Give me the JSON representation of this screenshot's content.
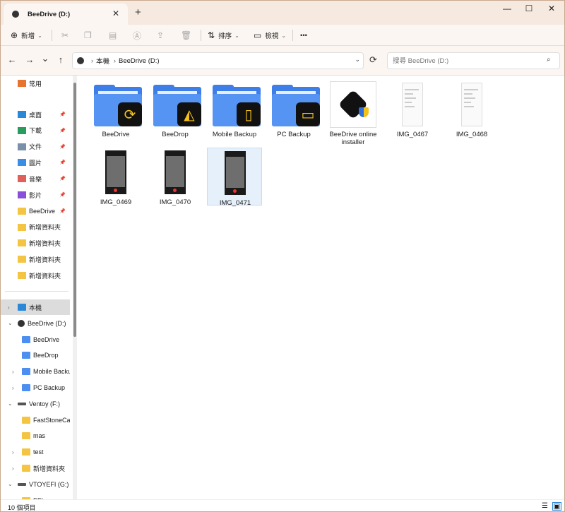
{
  "tab": {
    "title": "BeeDrive (D:)",
    "close": "✕",
    "new": "+"
  },
  "window": {
    "minimize": "—",
    "maximize": "☐",
    "close": "✕"
  },
  "toolbar": {
    "new_label": "新增",
    "sort_label": "排序",
    "view_label": "檢視",
    "more": "•••"
  },
  "nav": {
    "back": "←",
    "forward": "→",
    "recent": "⌄",
    "up": "↑",
    "refresh": "⟳",
    "breadcrumb": [
      "本機",
      "BeeDrive (D:)"
    ],
    "search_placeholder": "搜尋 BeeDrive (D:)"
  },
  "sidebar": {
    "home": "常用",
    "quick": [
      {
        "label": "桌面",
        "icon": "desktop-icon",
        "pinned": true
      },
      {
        "label": "下載",
        "icon": "download-icon",
        "pinned": true
      },
      {
        "label": "文件",
        "icon": "document-icon",
        "pinned": true
      },
      {
        "label": "圖片",
        "icon": "picture-icon",
        "pinned": true
      },
      {
        "label": "音樂",
        "icon": "music-icon",
        "pinned": true
      },
      {
        "label": "影片",
        "icon": "video-icon",
        "pinned": true
      },
      {
        "label": "BeeDrive",
        "icon": "folder-icon",
        "pinned": true
      },
      {
        "label": "新增資料夾",
        "icon": "folder-icon",
        "pinned": false
      },
      {
        "label": "新增資料夾",
        "icon": "folder-icon",
        "pinned": false
      },
      {
        "label": "新增資料夾",
        "icon": "folder-icon",
        "pinned": false
      },
      {
        "label": "新增資料夾",
        "icon": "folder-icon",
        "pinned": false
      }
    ],
    "tree": [
      {
        "label": "本機",
        "indent": 0,
        "exp": ">",
        "type": "pc"
      },
      {
        "label": "BeeDrive (D:)",
        "indent": 0,
        "exp": "v",
        "type": "drive"
      },
      {
        "label": "BeeDrive",
        "indent": 1,
        "exp": "",
        "type": "bd"
      },
      {
        "label": "BeeDrop",
        "indent": 1,
        "exp": "",
        "type": "bd"
      },
      {
        "label": "Mobile Backup",
        "indent": 1,
        "exp": ">",
        "type": "bd"
      },
      {
        "label": "PC Backup",
        "indent": 1,
        "exp": ">",
        "type": "bd"
      },
      {
        "label": "Ventoy (F:)",
        "indent": 0,
        "exp": "v",
        "type": "usb"
      },
      {
        "label": "FastStoneCapture",
        "indent": 1,
        "exp": "",
        "type": "folder"
      },
      {
        "label": "mas",
        "indent": 1,
        "exp": "",
        "type": "folder"
      },
      {
        "label": "test",
        "indent": 1,
        "exp": ">",
        "type": "folder"
      },
      {
        "label": "新增資料夾",
        "indent": 1,
        "exp": ">",
        "type": "folder"
      },
      {
        "label": "VTOYEFI (G:)",
        "indent": 0,
        "exp": "v",
        "type": "usb"
      },
      {
        "label": "EFI",
        "indent": 1,
        "exp": "",
        "type": "folder"
      }
    ]
  },
  "files": [
    {
      "name": "BeeDrive",
      "kind": "folder",
      "badge": "⟳"
    },
    {
      "name": "BeeDrop",
      "kind": "folder",
      "badge": "◭"
    },
    {
      "name": "Mobile Backup",
      "kind": "folder",
      "badge": "▯"
    },
    {
      "name": "PC Backup",
      "kind": "folder",
      "badge": "▭"
    },
    {
      "name": "BeeDrive online installer",
      "kind": "installer"
    },
    {
      "name": "IMG_0467",
      "kind": "light"
    },
    {
      "name": "IMG_0468",
      "kind": "light"
    },
    {
      "name": "IMG_0469",
      "kind": "dark"
    },
    {
      "name": "IMG_0470",
      "kind": "dark"
    },
    {
      "name": "IMG_0471",
      "kind": "dark",
      "selected": true
    }
  ],
  "status": {
    "count": "10 個項目"
  }
}
